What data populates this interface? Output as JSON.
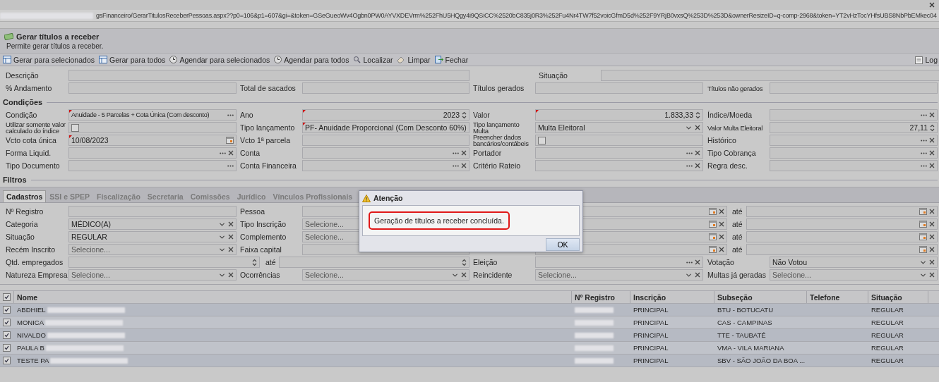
{
  "address_bar": {
    "url": "gsFinanceiro/GerarTitulosReceberPessoas.aspx??p0=106&p1=607&gi=&token=GSeGueoWv4Ogbn0PW0AYVXDEVrm%252FhU5HQgy4i9QSiCC%2520bC835j0R3%252Fu4Nr4TW7f52voicGfmD5d%252F9YRjB0vxsQ%253D%253D&ownerResizeID=q-comp-2968&token=YT2vHzTocYHfsUBS8NbPbEMkec04",
    "prefix_blurred": true
  },
  "header": {
    "title": "Gerar títulos a receber",
    "subtitle": "Permite gerar títulos a receber."
  },
  "toolbar": {
    "buttons": [
      {
        "kind": "generate",
        "label": "Gerar para selecionados"
      },
      {
        "kind": "generate",
        "label": "Gerar para todos"
      },
      {
        "kind": "schedule",
        "label": "Agendar para selecionados"
      },
      {
        "kind": "schedule",
        "label": "Agendar para todos"
      },
      {
        "kind": "search",
        "label": "Localizar"
      },
      {
        "kind": "clear",
        "label": "Limpar"
      },
      {
        "kind": "exit",
        "label": "Fechar"
      }
    ],
    "right_button": {
      "kind": "log",
      "label": "Log"
    }
  },
  "summary": {
    "rows": [
      {
        "kind": "wide",
        "cells": [
          {
            "label": "Descrição",
            "field": {
              "kind": "text"
            }
          },
          {
            "label": "Situação",
            "field": {
              "kind": "text"
            }
          }
        ]
      },
      {
        "kind": "quad",
        "cells": [
          {
            "label": "% Andamento",
            "field": {
              "kind": "text"
            }
          },
          {
            "label": "Total de sacados",
            "field": {
              "kind": "text"
            }
          },
          {
            "label": "Títulos gerados",
            "field": {
              "kind": "text"
            }
          },
          {
            "label": "Títulos não gerados",
            "field": {
              "kind": "text"
            }
          }
        ]
      }
    ]
  },
  "conditions": {
    "title": "Condições",
    "rows": [
      {
        "kind": "quad",
        "cells": [
          {
            "label": "Condição",
            "field": {
              "kind": "lookup",
              "value": "Anuidade - 5 Parcelas + Cota Única (Com desconto)",
              "required": true,
              "clearable": false
            }
          },
          {
            "label": "Ano",
            "field": {
              "kind": "spin",
              "value": "2023",
              "required": true
            }
          },
          {
            "label": "Valor",
            "field": {
              "kind": "spin",
              "value": "1.833,33",
              "required": true
            }
          },
          {
            "label": "Índice/Moeda",
            "field": {
              "kind": "lookup",
              "required": false,
              "clearable": true
            }
          }
        ]
      },
      {
        "kind": "quad",
        "cells": [
          {
            "label": "Utilizar somente valor calculado do índice",
            "field": {
              "kind": "check",
              "checked": false
            }
          },
          {
            "label": "Tipo lançamento",
            "field": {
              "kind": "select",
              "value": "PF- Anuidade Proporcional (Com Desconto 60%)",
              "required": true,
              "clearable": false
            }
          },
          {
            "label": "Tipo lançamento Multa",
            "field": {
              "kind": "select",
              "value": "Multa Eleitoral",
              "required": false,
              "clearable": true
            }
          },
          {
            "label": "Valor Multa Eleitoral",
            "field": {
              "kind": "spin",
              "value": "27,11",
              "required": false
            }
          }
        ]
      },
      {
        "kind": "quad",
        "cells": [
          {
            "label": "Vcto cota única",
            "field": {
              "kind": "date",
              "value": "10/08/2023",
              "required": true,
              "clearable": false
            }
          },
          {
            "label": "Vcto 1ª parcela",
            "field": {
              "kind": "text"
            }
          },
          {
            "label": "Preencher dados bancários/contábeis",
            "field": {
              "kind": "check",
              "checked": false
            }
          },
          {
            "label": "Histórico",
            "field": {
              "kind": "lookup",
              "required": false,
              "clearable": true
            }
          }
        ]
      },
      {
        "kind": "quad",
        "cells": [
          {
            "label": "Forma Liquid.",
            "field": {
              "kind": "lookup",
              "required": false,
              "clearable": true
            }
          },
          {
            "label": "Conta",
            "field": {
              "kind": "lookup",
              "required": false,
              "clearable": true
            }
          },
          {
            "label": "Portador",
            "field": {
              "kind": "lookup",
              "required": false,
              "clearable": true
            }
          },
          {
            "label": "Tipo Cobrança",
            "field": {
              "kind": "lookup",
              "required": false,
              "clearable": true
            }
          }
        ]
      },
      {
        "kind": "quad",
        "cells": [
          {
            "label": "Tipo Documento",
            "field": {
              "kind": "lookup",
              "required": false,
              "clearable": false
            }
          },
          {
            "label": "Conta Financeira",
            "field": {
              "kind": "lookup",
              "required": false,
              "clearable": true
            }
          },
          {
            "label": "Critério Rateio",
            "field": {
              "kind": "lookup",
              "required": false,
              "clearable": true
            }
          },
          {
            "label": "Regra desc.",
            "field": {
              "kind": "lookup",
              "required": false,
              "clearable": true
            }
          }
        ]
      }
    ]
  },
  "filters": {
    "title": "Filtros",
    "tabs": [
      {
        "label": "Cadastros",
        "selected": true
      },
      {
        "label": "SSI e SPEP",
        "selected": false
      },
      {
        "label": "Fiscalização",
        "selected": false
      },
      {
        "label": "Secretaria",
        "selected": false
      },
      {
        "label": "Comissões",
        "selected": false
      },
      {
        "label": "Jurídico",
        "selected": false
      },
      {
        "label": "Vínculos Profissionais",
        "selected": false
      }
    ],
    "rows": [
      {
        "kind": "date_range",
        "cells": [
          {
            "label": "Nº Registro",
            "field": {
              "kind": "text"
            }
          },
          {
            "label": "Pessoa",
            "field": {
              "kind": "text"
            }
          },
          {
            "from": {
              "kind": "date",
              "clearable": true
            },
            "to_label": "até",
            "to": {
              "kind": "date",
              "clearable": true
            }
          }
        ]
      },
      {
        "kind": "date_range",
        "cells": [
          {
            "label": "Categoria",
            "field": {
              "kind": "select",
              "value": "MÉDICO(A)",
              "clearable": true
            }
          },
          {
            "label": "Tipo Inscrição",
            "field": {
              "kind": "select",
              "placeholder": "Selecione..."
            }
          },
          {
            "from": {
              "kind": "date",
              "clearable": true
            },
            "to_label": "até",
            "to": {
              "kind": "date",
              "clearable": true
            }
          }
        ]
      },
      {
        "kind": "date_range",
        "cells": [
          {
            "label": "Situação",
            "field": {
              "kind": "select",
              "value": "REGULAR",
              "clearable": true
            }
          },
          {
            "label": "Complemento",
            "field": {
              "kind": "select",
              "placeholder": "Selecione..."
            }
          },
          {
            "from": {
              "kind": "date",
              "clearable": true
            },
            "to_label": "até",
            "to": {
              "kind": "date",
              "clearable": true
            }
          }
        ]
      },
      {
        "kind": "date_range",
        "cells": [
          {
            "label": "Recém Inscrito",
            "field": {
              "kind": "select",
              "placeholder": "Selecione...",
              "clearable": true
            }
          },
          {
            "label": "Faixa capital",
            "field": {
              "kind": "text"
            }
          },
          {
            "from": {
              "kind": "date",
              "clearable": true
            },
            "to_label": "até",
            "to": {
              "kind": "date",
              "clearable": true
            }
          }
        ]
      },
      {
        "kind": "qty_range",
        "cells": [
          {
            "label": "Qtd. empregados",
            "from": {
              "kind": "spin"
            },
            "to_label": "até",
            "to": {
              "kind": "spin"
            }
          },
          {
            "label": "Eleição",
            "field": {
              "kind": "lookup",
              "clearable": true
            }
          },
          {
            "label": "Votação",
            "field": {
              "kind": "select",
              "value": "Não Votou",
              "clearable": true
            }
          }
        ]
      },
      {
        "kind": "quad",
        "cells": [
          {
            "label": "Natureza Empresa",
            "field": {
              "kind": "select",
              "placeholder": "Selecione...",
              "clearable": true
            }
          },
          {
            "label": "Ocorrências",
            "field": {
              "kind": "select",
              "placeholder": "Selecione...",
              "clearable": true
            }
          },
          {
            "label": "Reincidente",
            "field": {
              "kind": "select",
              "placeholder": "Selecione...",
              "clearable": true
            }
          },
          {
            "label": "Multas já geradas",
            "field": {
              "kind": "select",
              "placeholder": "Selecione...",
              "clearable": true
            }
          }
        ]
      }
    ]
  },
  "grid": {
    "all_checked": true,
    "columns": [
      "Nome",
      "Nº Registro",
      "Inscrição",
      "Subseção",
      "Telefone",
      "Situação"
    ],
    "rows": [
      {
        "checked": true,
        "name": "ABDHIEL",
        "name_blurred": true,
        "registration_blurred": true,
        "inscricao": "PRINCIPAL",
        "subsecao": "BTU - BOTUCATU",
        "situacao": "REGULAR"
      },
      {
        "checked": true,
        "name": "MONICA",
        "name_blurred": true,
        "registration_blurred": true,
        "inscricao": "PRINCIPAL",
        "subsecao": "CAS - CAMPINAS",
        "situacao": "REGULAR"
      },
      {
        "checked": true,
        "name": "NIVALDO",
        "name_blurred": true,
        "registration_blurred": true,
        "inscricao": "PRINCIPAL",
        "subsecao": "TTE - TAUBATÉ",
        "situacao": "REGULAR"
      },
      {
        "checked": true,
        "name": "PAULA B",
        "name_blurred": true,
        "registration_blurred": true,
        "inscricao": "PRINCIPAL",
        "subsecao": "VMA - VILA MARIANA",
        "situacao": "REGULAR"
      },
      {
        "checked": true,
        "name": "TESTE PA",
        "name_blurred": true,
        "registration_blurred": true,
        "inscricao": "PRINCIPAL",
        "subsecao": "SBV - SÃO JOÃO DA BOA ...",
        "situacao": "REGULAR"
      }
    ]
  },
  "dialog": {
    "title": "Atenção",
    "message": "Geração de títulos a receber concluída.",
    "button": "OK"
  }
}
